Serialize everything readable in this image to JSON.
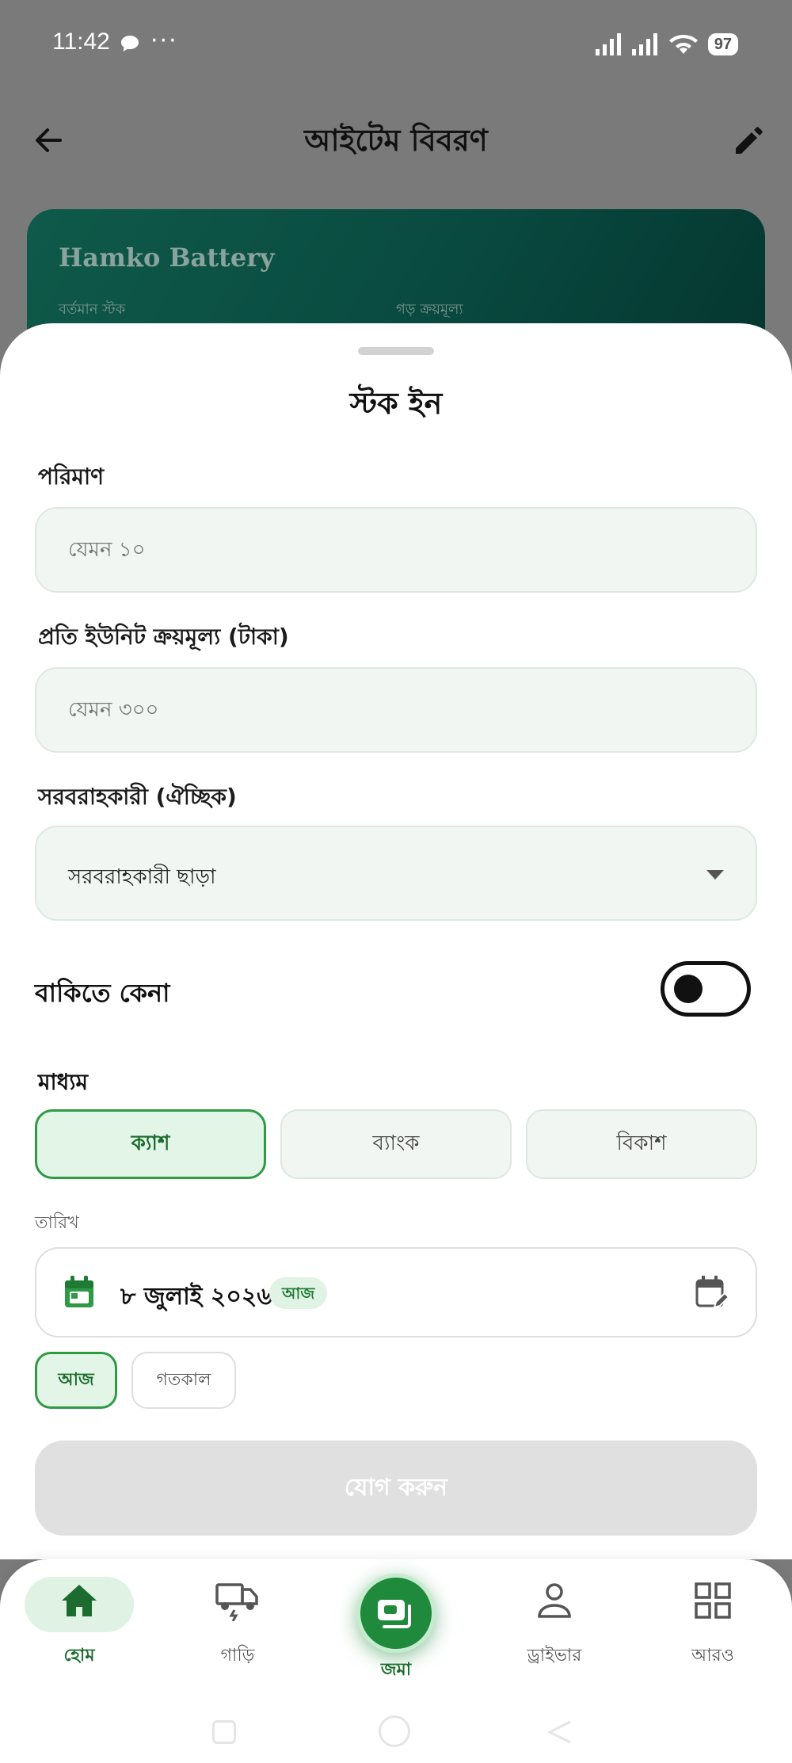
{
  "status_bar": {
    "time": "11:42",
    "dots": "···",
    "battery": "97"
  },
  "app_bar": {
    "title": "আইটেম বিবরণ"
  },
  "item_card": {
    "name": "Hamko Battery",
    "current_stock_label": "বর্তমান স্টক",
    "avg_cost_label": "গড় ক্রয়মূল্য"
  },
  "sheet": {
    "title": "স্টক ইন",
    "quantity": {
      "label": "পরিমাণ",
      "placeholder": "যেমন ১০",
      "value": ""
    },
    "unit_cost": {
      "label": "প্রতি ইউনিট ক্রয়মূল্য (টাকা)",
      "placeholder": "যেমন ৩০০",
      "value": ""
    },
    "supplier": {
      "label": "সরবরাহকারী (ঐচ্ছিক)",
      "selected": "সরবরাহকারী ছাড়া"
    },
    "credit_purchase": {
      "label": "বাকিতে কেনা",
      "enabled": false
    },
    "method": {
      "label": "মাধ্যম",
      "options": [
        "ক্যাশ",
        "ব্যাংক",
        "বিকাশ"
      ],
      "selected": "ক্যাশ"
    },
    "date": {
      "label": "তারিখ",
      "value": "৮ জুলাই ২০২৬",
      "badge": "আজ"
    },
    "date_chips": {
      "today": "আজ",
      "yesterday": "গতকাল",
      "selected": "আজ"
    },
    "submit_label": "যোগ করুন"
  },
  "bottom_nav": {
    "items": [
      {
        "label": "হোম",
        "icon": "home-icon",
        "active": true
      },
      {
        "label": "গাড়ি",
        "icon": "truck-icon",
        "active": false
      },
      {
        "label": "জমা",
        "icon": "cash-icon",
        "active": false
      },
      {
        "label": "ড্রাইভার",
        "icon": "person-icon",
        "active": false
      },
      {
        "label": "আরও",
        "icon": "grid-icon",
        "active": false
      }
    ]
  },
  "colors": {
    "accent": "#1f8a3c",
    "card": "#0a4d43",
    "overlay": "#7a7a7a"
  }
}
